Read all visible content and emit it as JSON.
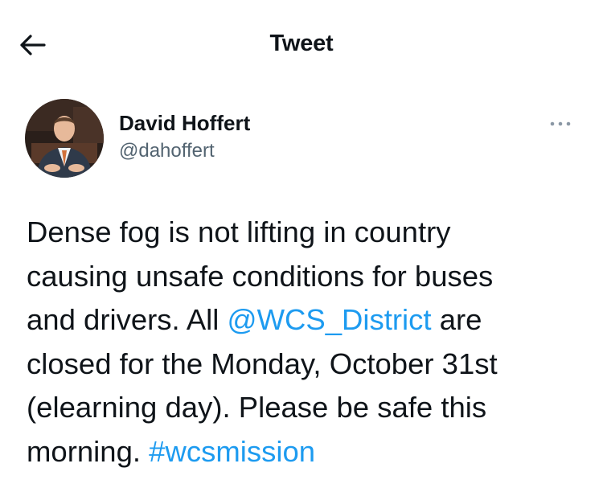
{
  "header": {
    "title": "Tweet",
    "back_icon": "arrow-left-icon"
  },
  "author": {
    "display_name": "David Hoffert",
    "handle": "@dahoffert",
    "avatar": "profile-photo"
  },
  "more_icon": "more-horizontal-icon",
  "tweet": {
    "line1": "Dense fog is not lifting in country",
    "line2": "causing unsafe conditions for buses",
    "line3_before": "and drivers. All ",
    "mention": "@WCS_District",
    "line3_after": " are",
    "line4": "closed for the Monday, October 31st",
    "line5": "(elearning day). Please be safe this",
    "line6_before": "morning. ",
    "hashtag": "#wcsmission"
  },
  "colors": {
    "link": "#1d9bf0",
    "text": "#0f1419",
    "secondary": "#536471"
  }
}
